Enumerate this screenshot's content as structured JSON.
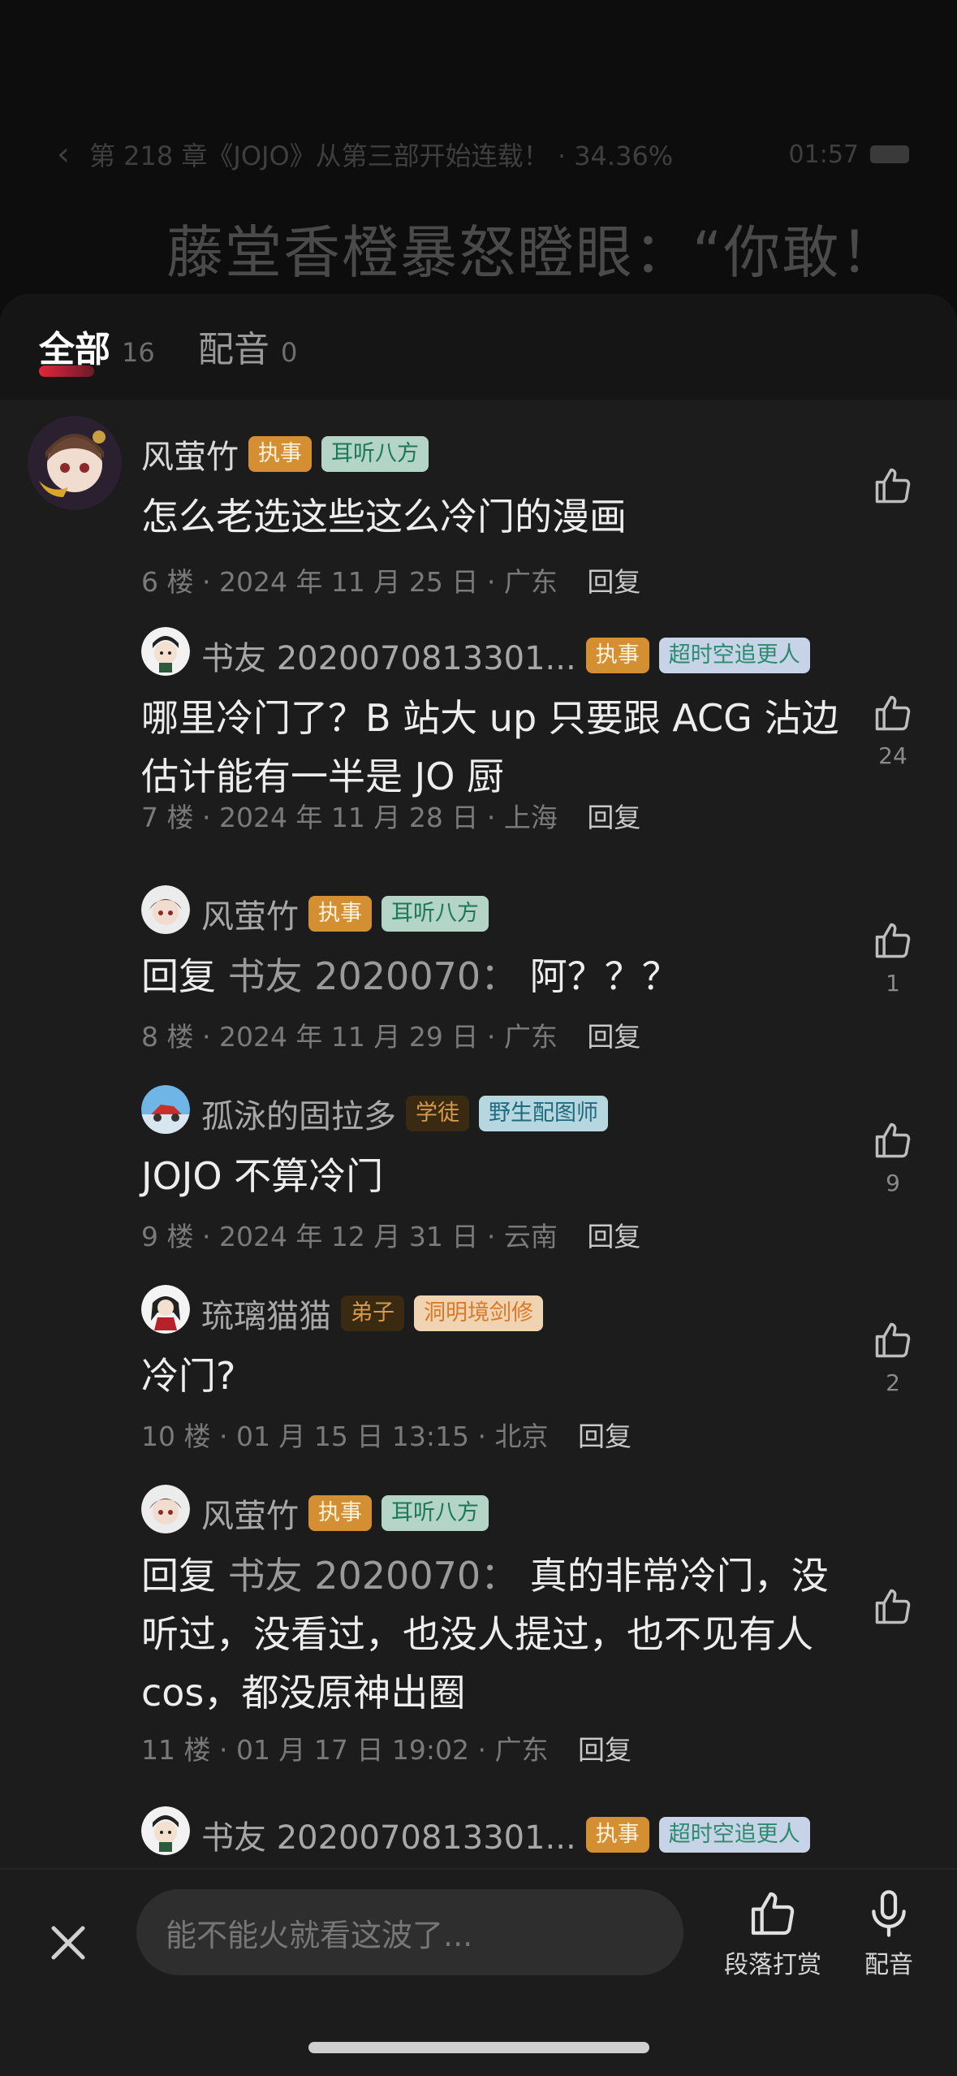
{
  "reader": {
    "chapter_line": "第 218 章《JOJO》从第三部开始连载！ · 34.36%",
    "time": "01:57",
    "title_text": "藤堂香橙暴怒瞪眼：“你敢！"
  },
  "tabs": [
    {
      "label": "全部",
      "count": "16"
    },
    {
      "label": "配音",
      "count": "0"
    }
  ],
  "comments": [
    {
      "user": "风萤竹",
      "badge1": "执事",
      "badge2": "耳听八方",
      "text": "怎么老选这些这么冷门的漫画",
      "meta": "6 楼 · 2024 年 11 月 25 日 · 广东",
      "reply": "回复",
      "likes": ""
    },
    {
      "user": "书友 2020070813301...",
      "badge1": "执事",
      "badge2": "超时空追更人",
      "text": "哪里冷门了？B 站大 up 只要跟 ACG 沾边估计能有一半是 JO 厨",
      "meta": "7 楼 · 2024 年 11 月 28 日 · 上海",
      "reply": "回复",
      "likes": "24"
    },
    {
      "user": "风萤竹",
      "badge1": "执事",
      "badge2": "耳听八方",
      "reply_prefix": "回复",
      "reply_target": "书友 2020070：",
      "text": "阿？？？",
      "meta": "8 楼 · 2024 年 11 月 29 日 · 广东",
      "reply": "回复",
      "likes": "1"
    },
    {
      "user": "孤泳的固拉多",
      "badge1": "学徒",
      "badge2": "野生配图师",
      "text": "JOJO 不算冷门",
      "meta": "9 楼 · 2024 年 12 月 31 日 · 云南",
      "reply": "回复",
      "likes": "9"
    },
    {
      "user": "琉璃猫猫",
      "badge1": "弟子",
      "badge2": "洞明境剑修",
      "text": "冷门?",
      "meta": "10 楼 · 01 月 15 日 13:15 · 北京",
      "reply": "回复",
      "likes": "2"
    },
    {
      "user": "风萤竹",
      "badge1": "执事",
      "badge2": "耳听八方",
      "reply_prefix": "回复",
      "reply_target": "书友 2020070：",
      "text": "真的非常冷门，没听过，没看过，也没人提过，也不见有人 cos，都没原神出圈",
      "meta": "11 楼 · 01 月 17 日 19:02 · 广东",
      "reply": "回复",
      "likes": ""
    },
    {
      "user": "书友 2020070813301...",
      "badge1": "执事",
      "badge2": "超时空追更人"
    }
  ],
  "bottom": {
    "input_placeholder": "能不能火就看这波了...",
    "tip_label": "段落打赏",
    "dub_label": "配音"
  },
  "icons": {
    "back": "chevron-left-icon",
    "like": "thumbs-up-icon",
    "close": "close-icon",
    "tip": "thumbs-up-outline-icon",
    "dub": "microphone-icon"
  }
}
